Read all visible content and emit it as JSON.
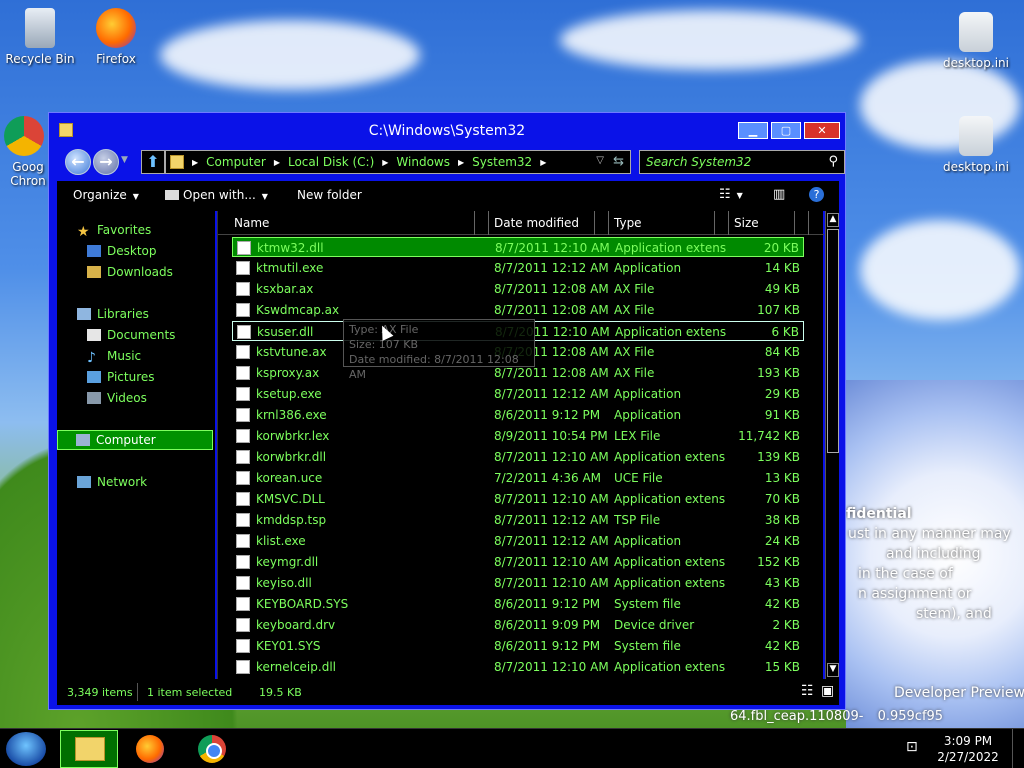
{
  "desktop": {
    "icons": [
      {
        "label": "Recycle Bin"
      },
      {
        "label": "Firefox"
      },
      {
        "label": "Goog Chron"
      },
      {
        "label": "desktop.ini"
      },
      {
        "label": "desktop.ini"
      }
    ],
    "wallpaper_text": {
      "line1": "fidential",
      "line2": "ust in any manner may",
      "line3": "and including",
      "line4": "in the case of",
      "line5": "n assignment or",
      "line6": "stem), and",
      "line7": "Developer Preview",
      "line8": "64.fbl_ceap.110809-",
      "line9": "0.959cf95"
    }
  },
  "window": {
    "title": "C:\\Windows\\System32",
    "min_glyph": "▁",
    "max_glyph": "▢",
    "close_glyph": "✕"
  },
  "navbar": {
    "back_glyph": "←",
    "forward_glyph": "→",
    "up_glyph": "⬆",
    "breadcrumbs": [
      "Computer",
      "Local Disk (C:)",
      "Windows",
      "System32"
    ],
    "search_placeholder": "Search System32"
  },
  "toolbar": {
    "organize": "Organize",
    "open_with": "Open with...",
    "new_folder": "New folder"
  },
  "nav_pane": {
    "favorites": "Favorites",
    "desktop": "Desktop",
    "downloads": "Downloads",
    "libraries": "Libraries",
    "documents": "Documents",
    "music": "Music",
    "pictures": "Pictures",
    "videos": "Videos",
    "computer": "Computer",
    "network": "Network"
  },
  "columns": {
    "name": "Name",
    "date": "Date modified",
    "type": "Type",
    "size": "Size"
  },
  "files": [
    {
      "name": "ktmw32.dll",
      "date": "8/7/2011 12:10 AM",
      "type": "Application extens...",
      "size": "20 KB"
    },
    {
      "name": "ktmutil.exe",
      "date": "8/7/2011 12:12 AM",
      "type": "Application",
      "size": "14 KB"
    },
    {
      "name": "ksxbar.ax",
      "date": "8/7/2011 12:08 AM",
      "type": "AX File",
      "size": "49 KB"
    },
    {
      "name": "Kswdmcap.ax",
      "date": "8/7/2011 12:08 AM",
      "type": "AX File",
      "size": "107 KB"
    },
    {
      "name": "ksuser.dll",
      "date": "8/7/2011 12:10 AM",
      "type": "Application extens...",
      "size": "6 KB"
    },
    {
      "name": "kstvtune.ax",
      "date": "8/7/2011 12:08 AM",
      "type": "AX File",
      "size": "84 KB"
    },
    {
      "name": "ksproxy.ax",
      "date": "8/7/2011 12:08 AM",
      "type": "AX File",
      "size": "193 KB"
    },
    {
      "name": "ksetup.exe",
      "date": "8/7/2011 12:12 AM",
      "type": "Application",
      "size": "29 KB"
    },
    {
      "name": "krnl386.exe",
      "date": "8/6/2011 9:12 PM",
      "type": "Application",
      "size": "91 KB"
    },
    {
      "name": "korwbrkr.lex",
      "date": "8/9/2011 10:54 PM",
      "type": "LEX File",
      "size": "11,742 KB"
    },
    {
      "name": "korwbrkr.dll",
      "date": "8/7/2011 12:10 AM",
      "type": "Application extens...",
      "size": "139 KB"
    },
    {
      "name": "korean.uce",
      "date": "7/2/2011 4:36 AM",
      "type": "UCE File",
      "size": "13 KB"
    },
    {
      "name": "KMSVC.DLL",
      "date": "8/7/2011 12:10 AM",
      "type": "Application extens...",
      "size": "70 KB"
    },
    {
      "name": "kmddsp.tsp",
      "date": "8/7/2011 12:12 AM",
      "type": "TSP File",
      "size": "38 KB"
    },
    {
      "name": "klist.exe",
      "date": "8/7/2011 12:12 AM",
      "type": "Application",
      "size": "24 KB"
    },
    {
      "name": "keymgr.dll",
      "date": "8/7/2011 12:10 AM",
      "type": "Application extens...",
      "size": "152 KB"
    },
    {
      "name": "keyiso.dll",
      "date": "8/7/2011 12:10 AM",
      "type": "Application extens...",
      "size": "43 KB"
    },
    {
      "name": "KEYBOARD.SYS",
      "date": "8/6/2011 9:12 PM",
      "type": "System file",
      "size": "42 KB"
    },
    {
      "name": "keyboard.drv",
      "date": "8/6/2011 9:09 PM",
      "type": "Device driver",
      "size": "2 KB"
    },
    {
      "name": "KEY01.SYS",
      "date": "8/6/2011 9:12 PM",
      "type": "System file",
      "size": "42 KB"
    },
    {
      "name": "kernelceip.dll",
      "date": "8/7/2011 12:10 AM",
      "type": "Application extens...",
      "size": "15 KB"
    }
  ],
  "tooltip": {
    "type": "Type: AX File",
    "size": "Size: 107 KB",
    "date": "Date modified: 8/7/2011 12:08 AM"
  },
  "status": {
    "count": "3,349 items",
    "selected": "1 item selected",
    "selected_size": "19.5 KB"
  },
  "taskbar": {
    "time": "3:09 PM",
    "date": "2/27/2022"
  },
  "colors": {
    "text_green": "#7dff5e",
    "window_frame": "#0a12e8",
    "selection": "#008a00"
  }
}
